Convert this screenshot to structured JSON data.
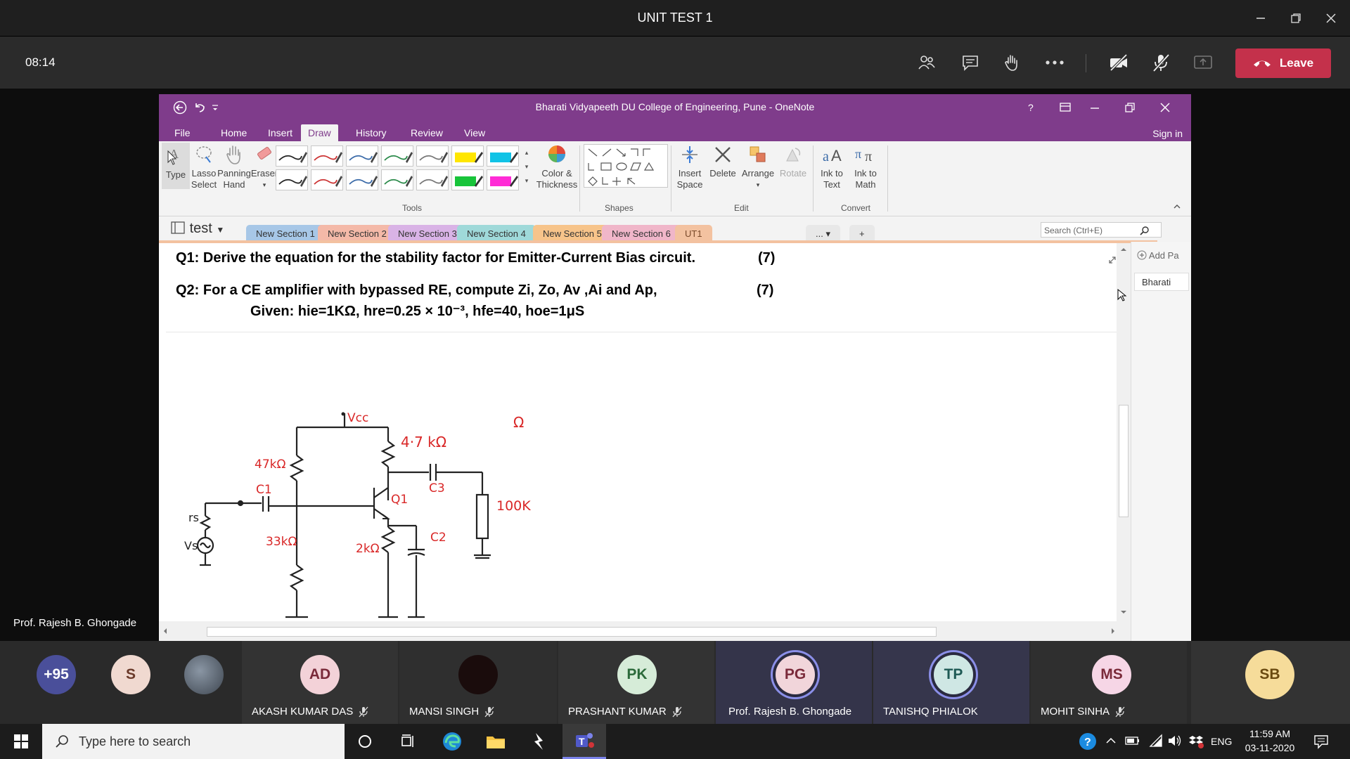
{
  "window": {
    "title": "UNIT TEST 1"
  },
  "meeting": {
    "timer": "08:14",
    "leave_label": "Leave",
    "icons": [
      "participants-icon",
      "chat-icon",
      "raise-hand-icon",
      "more-icon",
      "camera-off-icon",
      "mic-off-icon",
      "share-screen-icon"
    ],
    "leave_color": "#c4314b"
  },
  "onenote": {
    "title": "Bharati Vidyapeeth DU College of Engineering, Pune - OneNote",
    "menu_tabs": [
      "File",
      "Home",
      "Insert",
      "Draw",
      "History",
      "Review",
      "View"
    ],
    "active_tab": "Draw",
    "sign_in": "Sign in",
    "ribbon": {
      "type_label": "Type",
      "lasso_label": "Lasso\nSelect",
      "panning_label": "Panning\nHand",
      "eraser_label": "Eraser",
      "color_label": "Color &\nThickness",
      "insert_space_label": "Insert\nSpace",
      "delete_label": "Delete",
      "arrange_label": "Arrange",
      "rotate_label": "Rotate",
      "ink_text_label": "Ink to\nText",
      "ink_math_label": "Ink to\nMath",
      "groups": {
        "tools": "Tools",
        "shapes": "Shapes",
        "edit": "Edit",
        "convert": "Convert"
      }
    },
    "notebook": "test",
    "sections": [
      {
        "label": "New Section 1",
        "color": "#a7c7e7"
      },
      {
        "label": "New Section 2",
        "color": "#f4b9a8"
      },
      {
        "label": "New Section 3",
        "color": "#d9b3e6"
      },
      {
        "label": "New Section 4",
        "color": "#9fd9d9"
      },
      {
        "label": "New Section 5",
        "color": "#f7c48a"
      },
      {
        "label": "New Section 6",
        "color": "#f0b6c9"
      },
      {
        "label": "UT1",
        "color": "#f3c2a0"
      }
    ],
    "more_sections": "...",
    "add_section": "+",
    "search_placeholder": "Search (Ctrl+E)",
    "add_page": "Add Pa",
    "page_item": "Bharati",
    "q1": "Q1: Derive the equation for the stability factor for Emitter-Current Bias circuit.",
    "q1_marks": "(7)",
    "q2_line1": "Q2: For a CE amplifier with bypassed RE, compute  Zi, Zo, Av ,Ai and Ap,",
    "q2_line2": "Given: hie=1KΩ, hre=0.25 × 10⁻³,  hfe=40, hoe=1μS",
    "q2_marks": "(7)",
    "circuit_labels": {
      "vcc": "Vcc",
      "rc": "4·7 kΩ",
      "r1": "47kΩ",
      "r2": "33kΩ",
      "re": "2kΩ",
      "rl": "100K",
      "c1": "C1",
      "c2": "C2",
      "c3": "C3",
      "q1": "Q1",
      "rs": "rs",
      "vs": "Vs",
      "omega": "Ω"
    }
  },
  "presenter_label": "Prof. Rajesh B. Ghongade",
  "participants": [
    {
      "initials": "+95",
      "name": "",
      "color": "#4a4f9a"
    },
    {
      "initials": "S",
      "name": "",
      "color": "#f0d9d0"
    },
    {
      "initials": "",
      "name": "",
      "color": "#5a6470"
    },
    {
      "initials": "AD",
      "name": "AKASH KUMAR DAS",
      "color": "#f3d2d8"
    },
    {
      "initials": "",
      "name": "MANSI SINGH",
      "color": "#1a0c0c"
    },
    {
      "initials": "PK",
      "name": "PRASHANT KUMAR",
      "color": "#d6ecd8"
    },
    {
      "initials": "PG",
      "name": "Prof. Rajesh B. Ghongade",
      "color": "#f1d5da"
    },
    {
      "initials": "TP",
      "name": "TANISHQ PHIALOK",
      "color": "#cfe7e4"
    },
    {
      "initials": "MS",
      "name": "MOHIT SINHA",
      "color": "#f6d6e6"
    },
    {
      "initials": "SB",
      "name": "",
      "color": "#f6dc9a"
    }
  ],
  "taskbar": {
    "search_placeholder": "Type here to search",
    "time": "11:59 AM",
    "date": "03-11-2020",
    "lang": "ENG"
  }
}
